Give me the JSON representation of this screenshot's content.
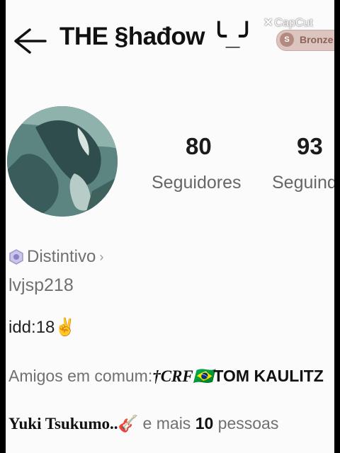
{
  "header": {
    "title": "THE §hađow ╰_╯",
    "watermark": "CapCut",
    "level_badge": "Bronze"
  },
  "profile": {
    "followers_count": "80",
    "followers_label": "Seguidores",
    "following_count": "93",
    "following_label": "Seguindo"
  },
  "badges": {
    "label": "Distintivo"
  },
  "bio": {
    "line1": "lvjsp218",
    "line2": "idd:18✌️"
  },
  "mutual_friends": {
    "prefix": "Amigos em comum:",
    "friend1": "†CRF🇧🇷",
    "friend2": "TOM KAULITZ",
    "friend3": "Yuki Tsukumo..🎸",
    "more_prefix": " e mais ",
    "more_count": "10",
    "more_suffix": " pessoas"
  },
  "colors": {
    "screen_bg": "#fbfbfb",
    "badge_bg": "#dcc5bf",
    "text_muted": "#707070"
  }
}
